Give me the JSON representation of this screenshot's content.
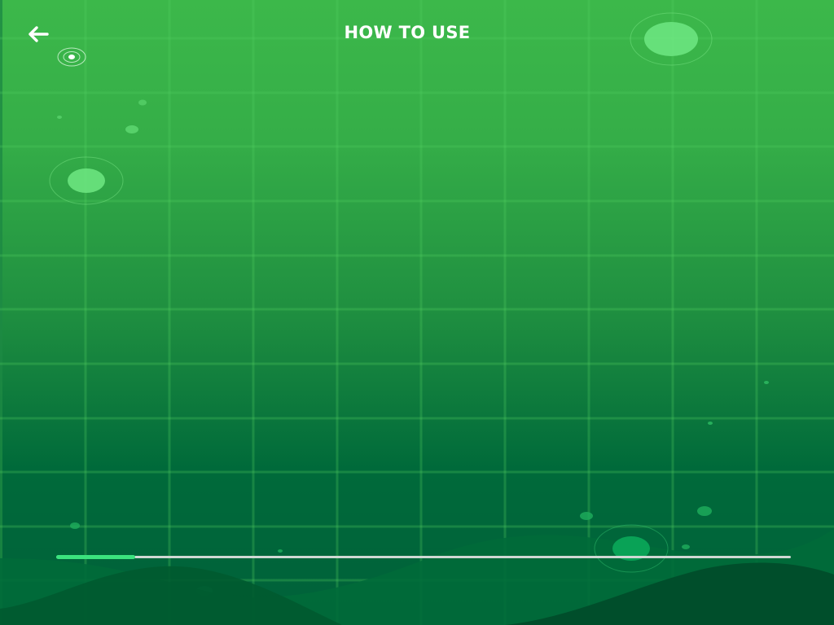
{
  "header": {
    "title": "HOW TO USE",
    "back_icon": "arrow-left-icon"
  },
  "progress": {
    "value": 0.108
  },
  "theme": {
    "top_color": "#3cb84a",
    "bottom_color": "#00673a",
    "accent": "#3be37e",
    "track": "#cfd8d3"
  }
}
